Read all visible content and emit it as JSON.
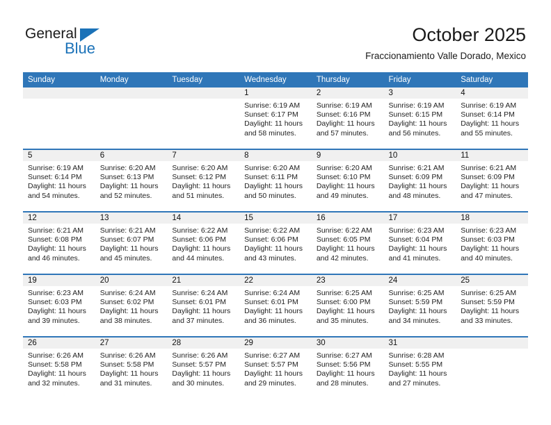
{
  "brand": {
    "name_top": "General",
    "name_bottom": "Blue",
    "accent_color": "#1b72b8"
  },
  "header": {
    "title": "October 2025",
    "subtitle": "Fraccionamiento Valle Dorado, Mexico"
  },
  "theme": {
    "header_blue": "#2f76b8",
    "daynum_band": "#f0f0f0",
    "text": "#222222"
  },
  "weekday_headers": [
    "Sunday",
    "Monday",
    "Tuesday",
    "Wednesday",
    "Thursday",
    "Friday",
    "Saturday"
  ],
  "weeks": [
    [
      {
        "day": "",
        "sunrise": "",
        "sunset": "",
        "daylight_line1": "",
        "daylight_line2": ""
      },
      {
        "day": "",
        "sunrise": "",
        "sunset": "",
        "daylight_line1": "",
        "daylight_line2": ""
      },
      {
        "day": "",
        "sunrise": "",
        "sunset": "",
        "daylight_line1": "",
        "daylight_line2": ""
      },
      {
        "day": "1",
        "sunrise": "Sunrise: 6:19 AM",
        "sunset": "Sunset: 6:17 PM",
        "daylight_line1": "Daylight: 11 hours",
        "daylight_line2": "and 58 minutes."
      },
      {
        "day": "2",
        "sunrise": "Sunrise: 6:19 AM",
        "sunset": "Sunset: 6:16 PM",
        "daylight_line1": "Daylight: 11 hours",
        "daylight_line2": "and 57 minutes."
      },
      {
        "day": "3",
        "sunrise": "Sunrise: 6:19 AM",
        "sunset": "Sunset: 6:15 PM",
        "daylight_line1": "Daylight: 11 hours",
        "daylight_line2": "and 56 minutes."
      },
      {
        "day": "4",
        "sunrise": "Sunrise: 6:19 AM",
        "sunset": "Sunset: 6:14 PM",
        "daylight_line1": "Daylight: 11 hours",
        "daylight_line2": "and 55 minutes."
      }
    ],
    [
      {
        "day": "5",
        "sunrise": "Sunrise: 6:19 AM",
        "sunset": "Sunset: 6:14 PM",
        "daylight_line1": "Daylight: 11 hours",
        "daylight_line2": "and 54 minutes."
      },
      {
        "day": "6",
        "sunrise": "Sunrise: 6:20 AM",
        "sunset": "Sunset: 6:13 PM",
        "daylight_line1": "Daylight: 11 hours",
        "daylight_line2": "and 52 minutes."
      },
      {
        "day": "7",
        "sunrise": "Sunrise: 6:20 AM",
        "sunset": "Sunset: 6:12 PM",
        "daylight_line1": "Daylight: 11 hours",
        "daylight_line2": "and 51 minutes."
      },
      {
        "day": "8",
        "sunrise": "Sunrise: 6:20 AM",
        "sunset": "Sunset: 6:11 PM",
        "daylight_line1": "Daylight: 11 hours",
        "daylight_line2": "and 50 minutes."
      },
      {
        "day": "9",
        "sunrise": "Sunrise: 6:20 AM",
        "sunset": "Sunset: 6:10 PM",
        "daylight_line1": "Daylight: 11 hours",
        "daylight_line2": "and 49 minutes."
      },
      {
        "day": "10",
        "sunrise": "Sunrise: 6:21 AM",
        "sunset": "Sunset: 6:09 PM",
        "daylight_line1": "Daylight: 11 hours",
        "daylight_line2": "and 48 minutes."
      },
      {
        "day": "11",
        "sunrise": "Sunrise: 6:21 AM",
        "sunset": "Sunset: 6:09 PM",
        "daylight_line1": "Daylight: 11 hours",
        "daylight_line2": "and 47 minutes."
      }
    ],
    [
      {
        "day": "12",
        "sunrise": "Sunrise: 6:21 AM",
        "sunset": "Sunset: 6:08 PM",
        "daylight_line1": "Daylight: 11 hours",
        "daylight_line2": "and 46 minutes."
      },
      {
        "day": "13",
        "sunrise": "Sunrise: 6:21 AM",
        "sunset": "Sunset: 6:07 PM",
        "daylight_line1": "Daylight: 11 hours",
        "daylight_line2": "and 45 minutes."
      },
      {
        "day": "14",
        "sunrise": "Sunrise: 6:22 AM",
        "sunset": "Sunset: 6:06 PM",
        "daylight_line1": "Daylight: 11 hours",
        "daylight_line2": "and 44 minutes."
      },
      {
        "day": "15",
        "sunrise": "Sunrise: 6:22 AM",
        "sunset": "Sunset: 6:06 PM",
        "daylight_line1": "Daylight: 11 hours",
        "daylight_line2": "and 43 minutes."
      },
      {
        "day": "16",
        "sunrise": "Sunrise: 6:22 AM",
        "sunset": "Sunset: 6:05 PM",
        "daylight_line1": "Daylight: 11 hours",
        "daylight_line2": "and 42 minutes."
      },
      {
        "day": "17",
        "sunrise": "Sunrise: 6:23 AM",
        "sunset": "Sunset: 6:04 PM",
        "daylight_line1": "Daylight: 11 hours",
        "daylight_line2": "and 41 minutes."
      },
      {
        "day": "18",
        "sunrise": "Sunrise: 6:23 AM",
        "sunset": "Sunset: 6:03 PM",
        "daylight_line1": "Daylight: 11 hours",
        "daylight_line2": "and 40 minutes."
      }
    ],
    [
      {
        "day": "19",
        "sunrise": "Sunrise: 6:23 AM",
        "sunset": "Sunset: 6:03 PM",
        "daylight_line1": "Daylight: 11 hours",
        "daylight_line2": "and 39 minutes."
      },
      {
        "day": "20",
        "sunrise": "Sunrise: 6:24 AM",
        "sunset": "Sunset: 6:02 PM",
        "daylight_line1": "Daylight: 11 hours",
        "daylight_line2": "and 38 minutes."
      },
      {
        "day": "21",
        "sunrise": "Sunrise: 6:24 AM",
        "sunset": "Sunset: 6:01 PM",
        "daylight_line1": "Daylight: 11 hours",
        "daylight_line2": "and 37 minutes."
      },
      {
        "day": "22",
        "sunrise": "Sunrise: 6:24 AM",
        "sunset": "Sunset: 6:01 PM",
        "daylight_line1": "Daylight: 11 hours",
        "daylight_line2": "and 36 minutes."
      },
      {
        "day": "23",
        "sunrise": "Sunrise: 6:25 AM",
        "sunset": "Sunset: 6:00 PM",
        "daylight_line1": "Daylight: 11 hours",
        "daylight_line2": "and 35 minutes."
      },
      {
        "day": "24",
        "sunrise": "Sunrise: 6:25 AM",
        "sunset": "Sunset: 5:59 PM",
        "daylight_line1": "Daylight: 11 hours",
        "daylight_line2": "and 34 minutes."
      },
      {
        "day": "25",
        "sunrise": "Sunrise: 6:25 AM",
        "sunset": "Sunset: 5:59 PM",
        "daylight_line1": "Daylight: 11 hours",
        "daylight_line2": "and 33 minutes."
      }
    ],
    [
      {
        "day": "26",
        "sunrise": "Sunrise: 6:26 AM",
        "sunset": "Sunset: 5:58 PM",
        "daylight_line1": "Daylight: 11 hours",
        "daylight_line2": "and 32 minutes."
      },
      {
        "day": "27",
        "sunrise": "Sunrise: 6:26 AM",
        "sunset": "Sunset: 5:58 PM",
        "daylight_line1": "Daylight: 11 hours",
        "daylight_line2": "and 31 minutes."
      },
      {
        "day": "28",
        "sunrise": "Sunrise: 6:26 AM",
        "sunset": "Sunset: 5:57 PM",
        "daylight_line1": "Daylight: 11 hours",
        "daylight_line2": "and 30 minutes."
      },
      {
        "day": "29",
        "sunrise": "Sunrise: 6:27 AM",
        "sunset": "Sunset: 5:57 PM",
        "daylight_line1": "Daylight: 11 hours",
        "daylight_line2": "and 29 minutes."
      },
      {
        "day": "30",
        "sunrise": "Sunrise: 6:27 AM",
        "sunset": "Sunset: 5:56 PM",
        "daylight_line1": "Daylight: 11 hours",
        "daylight_line2": "and 28 minutes."
      },
      {
        "day": "31",
        "sunrise": "Sunrise: 6:28 AM",
        "sunset": "Sunset: 5:55 PM",
        "daylight_line1": "Daylight: 11 hours",
        "daylight_line2": "and 27 minutes."
      },
      {
        "day": "",
        "sunrise": "",
        "sunset": "",
        "daylight_line1": "",
        "daylight_line2": ""
      }
    ]
  ]
}
